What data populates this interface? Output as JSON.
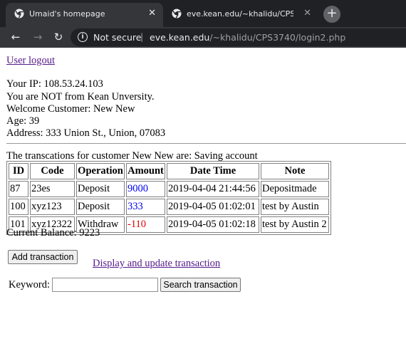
{
  "browser": {
    "tabs": [
      {
        "title": "Umaid's homepage",
        "close": "✕"
      },
      {
        "title": "eve.kean.edu/~khalidu/CPS3740",
        "close": "✕"
      }
    ],
    "new_tab": "+",
    "nav": {
      "back": "←",
      "forward": "→",
      "reload": "↻"
    },
    "security_text": "Not secure",
    "url_separator": "|",
    "url_host": "eve.kean.edu",
    "url_path": "/~khalidu/CPS3740/login2.php"
  },
  "page": {
    "logout_link": "User logout",
    "ip_line": "Your IP: 108.53.24.103",
    "kean_line": "You are NOT from Kean Unversity.",
    "welcome_line": "Welcome Customer: New New",
    "age_line": "Age: 39",
    "address_line": "Address: 333 Union St., Union, 07083",
    "transactions_caption": "The transcations for customer New New are: Saving account",
    "table": {
      "headers": [
        "ID",
        "Code",
        "Operation",
        "Amount",
        "Date Time",
        "Note"
      ],
      "rows": [
        {
          "id": "87",
          "code": "23es",
          "operation": "Deposit",
          "amount": "9000",
          "datetime": "2019-04-04 21:44:56",
          "note": "Depositmade"
        },
        {
          "id": "100",
          "code": "xyz123",
          "operation": "Deposit",
          "amount": "333",
          "datetime": "2019-04-05 01:02:01",
          "note": "test by Austin"
        },
        {
          "id": "101",
          "code": "xyz12322",
          "operation": "Withdraw",
          "amount": "-110",
          "datetime": "2019-04-05 01:02:18",
          "note": "test by Austin 2"
        }
      ]
    },
    "balance_line": "Current Balance: 9223",
    "add_button": "Add transaction",
    "display_link": "Display and update transaction",
    "keyword_label": "Keyword:",
    "keyword_value": "",
    "search_button": "Search transaction"
  },
  "colors": {
    "positive_amount": "#0000ee",
    "negative_amount": "#e00000",
    "link_visited": "#551a8b"
  }
}
